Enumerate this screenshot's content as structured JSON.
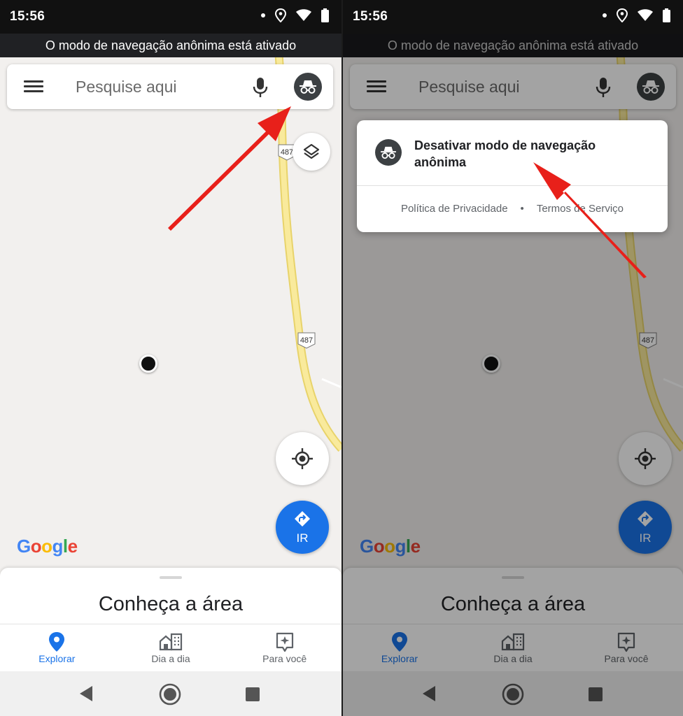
{
  "status_bar": {
    "time": "15:56"
  },
  "incognito_banner": "O modo de navegação anônima está ativado",
  "search": {
    "placeholder": "Pesquise aqui"
  },
  "map": {
    "route_label": "487"
  },
  "go_button": {
    "label": "IR"
  },
  "google_logo": [
    "G",
    "o",
    "o",
    "g",
    "l",
    "e"
  ],
  "bottom_sheet": {
    "title": "Conheça a área"
  },
  "bottom_nav": {
    "items": [
      {
        "label": "Explorar",
        "icon": "place-pin-icon",
        "active": true
      },
      {
        "label": "Dia a dia",
        "icon": "commute-building-icon",
        "active": false
      },
      {
        "label": "Para você",
        "icon": "for-you-sparkle-icon",
        "active": false
      }
    ]
  },
  "popup": {
    "title": "Desativar modo de navegação anônima",
    "privacy_link": "Política de Privacidade",
    "separator": "•",
    "terms_link": "Termos de Serviço"
  },
  "colors": {
    "accent": "#1a73e8",
    "road": "#f7e38a",
    "arrow": "#e8201a",
    "incognito": "#3c4043"
  }
}
